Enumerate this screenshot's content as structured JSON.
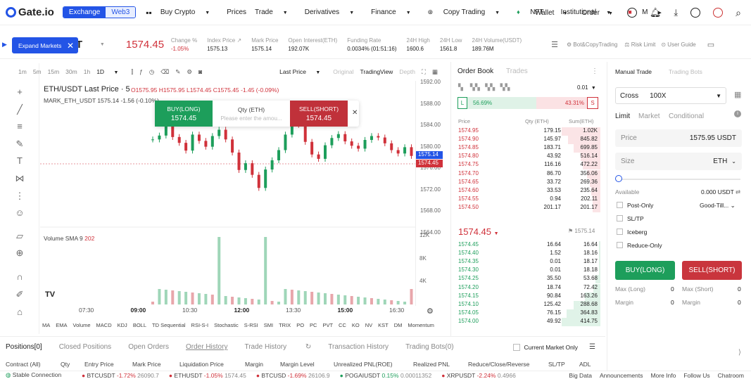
{
  "nav": {
    "brand": "Gate.io",
    "seg_exchange": "Exchange",
    "seg_web3": "Web3",
    "items": [
      "Buy Crypto",
      "Prices",
      "Trade",
      "Derivatives",
      "Finance",
      "Copy Trading",
      "NFT",
      "Institutional",
      "M"
    ],
    "wallet": "Wallet",
    "order": "Order"
  },
  "market": {
    "pair": "T",
    "price": "1574.45",
    "stats": [
      {
        "label": "Change %",
        "value": "-1.05%"
      },
      {
        "label": "Index Price",
        "value": "1575.13"
      },
      {
        "label": "Mark Price",
        "value": "1575.14"
      },
      {
        "label": "Open Interest(ETH)",
        "value": "192.07K"
      },
      {
        "label": "Funding Rate",
        "value": "0.0034% (01:51:16)"
      },
      {
        "label": "24H High",
        "value": "1600.6"
      },
      {
        "label": "24H Low",
        "value": "1561.8"
      },
      {
        "label": "24H Volume(USDT)",
        "value": "189.76M"
      }
    ],
    "bot_copy": "Bot&CopyTrading",
    "risk_limit": "Risk Limit",
    "user_guide": "User Guide"
  },
  "expand": {
    "label": "Expand Markets"
  },
  "chart_toolbar": {
    "intervals": [
      "1m",
      "5m",
      "15m",
      "30m",
      "1h",
      "1D"
    ],
    "last_price": "Last Price",
    "original": "Original",
    "tradingview": "TradingView",
    "depth": "Depth"
  },
  "chart_header": {
    "title": "ETH/USDT Last Price · 5",
    "o": "O1575.95",
    "h": "H1575.95",
    "l": "L1574.45",
    "c": "C1575.45",
    "chg": "-1.45 (-0.09%)",
    "mark": "MARK_ETH_USDT  1575.14  -1.56  (-0.10%)",
    "volume": "Volume SMA 9",
    "volume_val": "202"
  },
  "quick_trade": {
    "buy_label": "BUY(LONG)",
    "buy_price": "1574.45",
    "qty_label": "Qty (ETH)",
    "qty_placeholder": "Please enter the amou...",
    "sell_label": "SELL(SHORT)",
    "sell_price": "1574.45"
  },
  "chart_data": {
    "type": "line",
    "title": "ETH/USDT Last Price",
    "x": [
      "07:30",
      "09:00",
      "10:30",
      "12:00",
      "13:30",
      "15:00",
      "16:30"
    ],
    "yticks": [
      "1592.00",
      "1588.00",
      "1584.00",
      "1580.00",
      "1576.00",
      "1572.00",
      "1568.00",
      "1564.00"
    ],
    "ylim": [
      1563,
      1592
    ],
    "volume_ticks": [
      "12K",
      "8K",
      "4K"
    ],
    "last_price_label": "1574.45",
    "mark_price_label": "1575.14",
    "series": [
      {
        "values": [
          1580.5,
          1581.3,
          1584.2,
          1581.0,
          1579.8,
          1578.2,
          1581.5,
          1580.2,
          1579.0,
          1581.2,
          1582.5,
          1580.5,
          1577.8,
          1574.2,
          1575.6,
          1573.2,
          1570.5,
          1574.3,
          1576.2,
          1578.3,
          1581.5,
          1584.8,
          1583.5,
          1580.0,
          1577.4,
          1576.5,
          1579.3,
          1580.8,
          1581.6,
          1580.1,
          1579.2,
          1578.6,
          1580.4,
          1581.2,
          1580.9,
          1579.7,
          1578.3,
          1577.6,
          1578.9,
          1577.1,
          1576.4,
          1576.0,
          1576.9,
          1578.1,
          1577.2,
          1576.3,
          1575.6,
          1576.8,
          1575.5,
          1574.6,
          1575.9,
          1575.1
        ]
      }
    ]
  },
  "indicators": [
    "MA",
    "EMA",
    "Volume",
    "MACD",
    "KDJ",
    "BOLL",
    "TD Sequential",
    "RSI-S-I",
    "Stochastic",
    "S-RSI",
    "SMI",
    "TRIX",
    "PO",
    "PC",
    "PVT",
    "CC",
    "KO",
    "NV",
    "KST",
    "DM",
    "Momentum"
  ],
  "orderbook": {
    "tab_book": "Order Book",
    "tab_trades": "Trades",
    "precision": "0.01",
    "buy_pct": "56.69%",
    "sell_pct": "43.31%",
    "hdr_price": "Price",
    "hdr_amt": "Qty (ETH)",
    "hdr_sum": "Sum(ETH)",
    "asks": [
      [
        "1574.95",
        "179.15",
        "1.02K"
      ],
      [
        "1574.90",
        "145.97",
        "845.82"
      ],
      [
        "1574.85",
        "183.71",
        "699.85"
      ],
      [
        "1574.80",
        "43.92",
        "516.14"
      ],
      [
        "1574.75",
        "116.16",
        "472.22"
      ],
      [
        "1574.70",
        "86.70",
        "356.06"
      ],
      [
        "1574.65",
        "33.72",
        "269.36"
      ],
      [
        "1574.60",
        "33.53",
        "235.64"
      ],
      [
        "1574.55",
        "0.94",
        "202.11"
      ],
      [
        "1574.50",
        "201.17",
        "201.17"
      ]
    ],
    "last": "1574.45",
    "mark": "1575.14",
    "bids": [
      [
        "1574.45",
        "16.64",
        "16.64"
      ],
      [
        "1574.40",
        "1.52",
        "18.16"
      ],
      [
        "1574.35",
        "0.01",
        "18.17"
      ],
      [
        "1574.30",
        "0.01",
        "18.18"
      ],
      [
        "1574.25",
        "35.50",
        "53.68"
      ],
      [
        "1574.20",
        "18.74",
        "72.42"
      ],
      [
        "1574.15",
        "90.84",
        "163.26"
      ],
      [
        "1574.10",
        "125.42",
        "288.68"
      ],
      [
        "1574.05",
        "76.15",
        "364.83"
      ],
      [
        "1574.00",
        "49.92",
        "414.75"
      ]
    ]
  },
  "order_form": {
    "tab_manual": "Manual Trade",
    "tab_bots": "Trading Bots",
    "margin_mode": "Cross",
    "leverage": "100X",
    "types": [
      "Limit",
      "Market",
      "Conditional"
    ],
    "price_label": "Price",
    "price_value": "1575.95 USDT",
    "size_label": "Size",
    "size_unit": "ETH",
    "available_label": "Available",
    "available_value": "0.000 USDT",
    "post_only": "Post-Only",
    "tif": "Good-Till...",
    "sltp": "SL/TP",
    "iceberg": "Iceberg",
    "reduce_only": "Reduce-Only",
    "buy": "BUY(LONG)",
    "sell": "SELL(SHORT)",
    "max_long": "Max (Long)",
    "max_long_v": "0",
    "max_short": "Max (Short)",
    "max_short_v": "0",
    "margin": "Margin",
    "margin_v": "0",
    "margin2": "Margin",
    "margin2_v": "0"
  },
  "bottom_tabs": [
    "Positions[0]",
    "Closed Positions",
    "Open Orders",
    "Order History",
    "Trade History",
    "Transaction History",
    "Trading Bots(0)"
  ],
  "current_market_only": "Current Market Only",
  "columns": [
    "Contract (All)",
    "Qty",
    "Entry Price",
    "Mark Price",
    "Liquidation Price",
    "Margin",
    "Margin Level",
    "Unrealized PNL(ROE)",
    "Realized PNL",
    "Reduce/Close/Reverse",
    "SL/TP",
    "ADL"
  ],
  "ticker": {
    "conn": "Stable Connection",
    "items": [
      {
        "sym": "BTCUSDT",
        "chg": "-1.72%",
        "px": "26090.7"
      },
      {
        "sym": "ETHUSDT",
        "chg": "-1.05%",
        "px": "1574.45"
      },
      {
        "sym": "BTCUSD",
        "chg": "-1.69%",
        "px": "26106.9"
      },
      {
        "sym": "POGAIUSDT",
        "chg": "0.15%",
        "px": "0.00011352"
      },
      {
        "sym": "XRPUSDT",
        "chg": "-2.24%",
        "px": "0.4966"
      }
    ],
    "links": [
      "Big Data",
      "Announcements",
      "More Info",
      "Follow Us",
      "Chatroom"
    ]
  },
  "colors": {
    "accent": "#2354e6",
    "up": "#1d9e5b",
    "down": "#d0313a"
  }
}
